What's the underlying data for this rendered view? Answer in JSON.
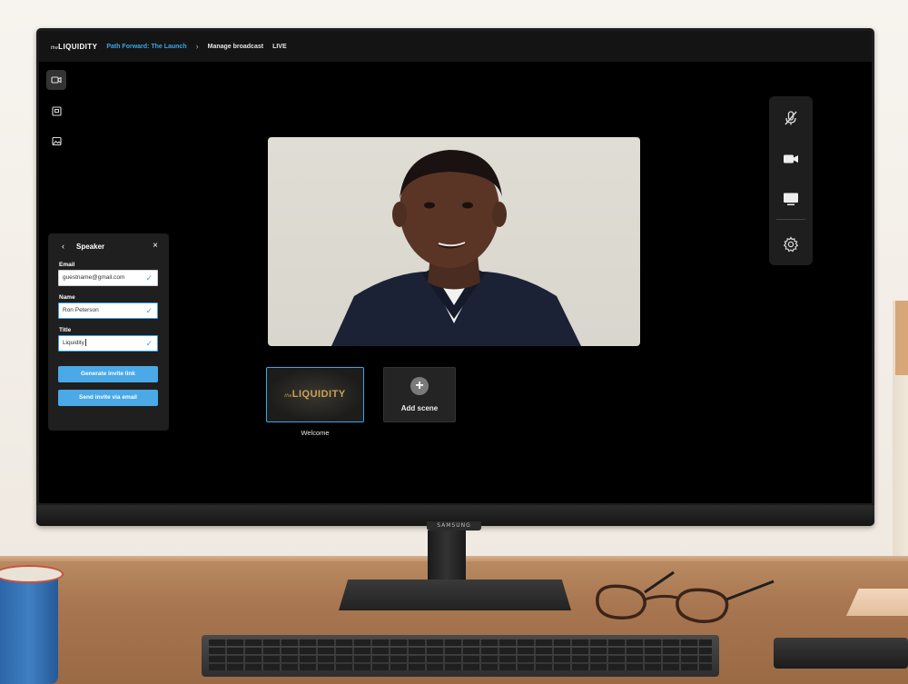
{
  "topbar": {
    "logo_prefix": "the",
    "logo": "LIQUIDITY",
    "event_link": "Path Forward: The Launch",
    "separator": "›",
    "page": "Manage broadcast",
    "status": "LIVE"
  },
  "left_rail": {
    "items": [
      {
        "icon": "camera-icon",
        "active": true
      },
      {
        "icon": "share-screen-icon",
        "active": false
      },
      {
        "icon": "image-icon",
        "active": false
      }
    ]
  },
  "toolbar": {
    "items": [
      "mic-off-icon",
      "video-camera-icon",
      "monitor-icon",
      "gear-icon"
    ]
  },
  "speaker_panel": {
    "title": "Speaker",
    "back": "‹",
    "close": "×",
    "email_label": "Email",
    "email_value": "guestname@gmail.com",
    "name_label": "Name",
    "name_value": "Ron Peterson",
    "title_label": "Title",
    "title_value": "Liquidity",
    "check": "✓",
    "generate_button": "Generate invite link",
    "send_button": "Send invite via email"
  },
  "scenes": {
    "items": [
      {
        "label": "Welcome",
        "logo_prefix": "the",
        "logo": "LIQUIDITY"
      }
    ],
    "add_label": "Add scene",
    "add_icon": "+"
  },
  "monitor": {
    "brand": "SAMSUNG"
  },
  "colors": {
    "accent": "#3aa7e6",
    "button": "#4aa9e6",
    "scene_gold": "#c9a253"
  }
}
